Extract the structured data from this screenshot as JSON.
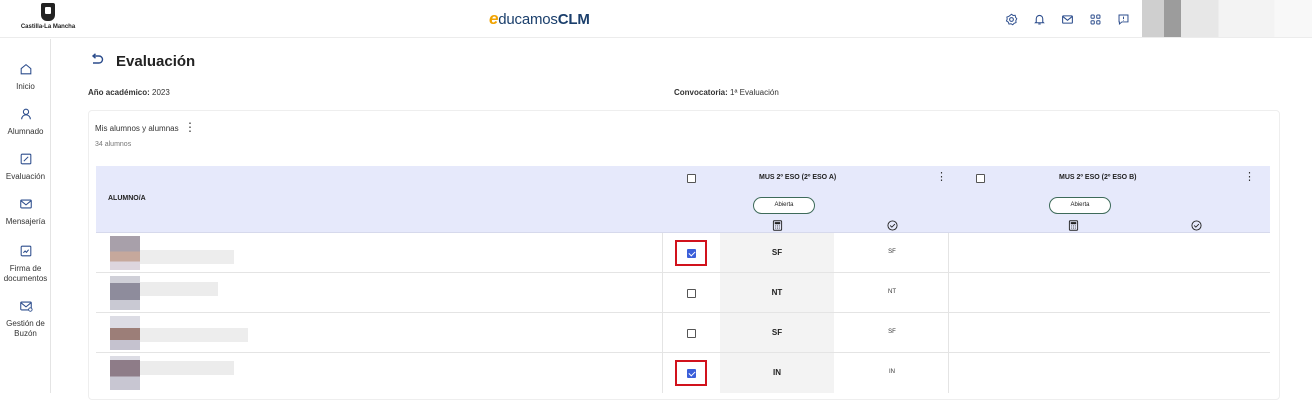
{
  "header": {
    "logo_text": "Castilla-La Mancha",
    "brand_e": "e",
    "brand_text": "ducamos",
    "brand_clm": "CLM",
    "icons": [
      "settings-icon",
      "bell-icon",
      "mail-icon",
      "apps-icon",
      "feedback-icon"
    ]
  },
  "sidebar": {
    "items": [
      {
        "label": "Inicio",
        "icon": "home-icon"
      },
      {
        "label": "Alumnado",
        "icon": "user-icon"
      },
      {
        "label": "Evaluación",
        "icon": "edit-icon"
      },
      {
        "label": "Mensajería",
        "icon": "mail-icon"
      },
      {
        "label": "Firma de documentos",
        "icon": "sign-icon"
      },
      {
        "label": "Gestión de Buzón",
        "icon": "mailbox-icon"
      }
    ]
  },
  "page": {
    "title": "Evaluación",
    "year_label": "Año académico:",
    "year_value": "2023",
    "conv_label": "Convocatoria:",
    "conv_value": "1ª Evaluación"
  },
  "group": {
    "title": "Mis alumnos y alumnas",
    "count": "34 alumnos"
  },
  "table": {
    "student_header": "ALUMNO/A",
    "courses": [
      {
        "label": "MUS 2º ESO (2º ESO A)",
        "status": "Abierta"
      },
      {
        "label": "MUS 2º ESO (2º ESO B)",
        "status": "Abierta"
      }
    ],
    "rows": [
      {
        "checked": true,
        "highlighted": true,
        "grade": "SF",
        "grade_small": "SF"
      },
      {
        "checked": false,
        "highlighted": false,
        "grade": "NT",
        "grade_small": "NT"
      },
      {
        "checked": false,
        "highlighted": false,
        "grade": "SF",
        "grade_small": "SF"
      },
      {
        "checked": true,
        "highlighted": true,
        "grade": "IN",
        "grade_small": "IN"
      }
    ]
  },
  "colors": {
    "accent": "#3b5fd9",
    "highlight": "#d1121c",
    "header_bg": "#e6e9fb",
    "brand_blue": "#1b3f6c",
    "brand_orange": "#f1a300"
  }
}
